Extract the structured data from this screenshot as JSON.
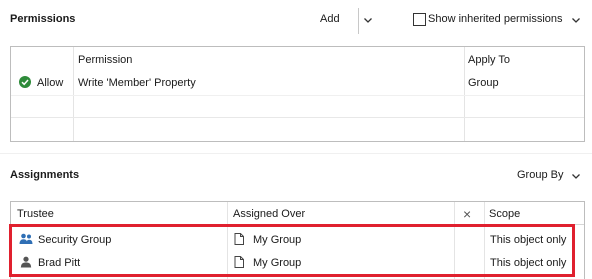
{
  "permissions": {
    "title": "Permissions",
    "add_label": "Add",
    "show_inherited_label": "Show inherited permissions",
    "show_inherited_checked": false,
    "columns": [
      "Permission",
      "Apply To"
    ],
    "rows": [
      {
        "access": "Allow",
        "permission": "Write 'Member' Property",
        "apply_to": "Group"
      }
    ]
  },
  "assignments": {
    "title": "Assignments",
    "group_by_label": "Group By",
    "columns": {
      "trustee": "Trustee",
      "assigned_over": "Assigned Over",
      "clear_icon": "×",
      "scope": "Scope"
    },
    "rows": [
      {
        "trustee": "Security Group",
        "trustee_icon": "group-icon",
        "assigned_over": "My Group",
        "scope": "This object only"
      },
      {
        "trustee": "Brad Pitt",
        "trustee_icon": "user-icon",
        "assigned_over": "My Group",
        "scope": "This object only"
      }
    ]
  },
  "colors": {
    "highlight": "#e0202e",
    "allow_green": "#2e8b3a",
    "user_blue": "#2f6fb5"
  }
}
